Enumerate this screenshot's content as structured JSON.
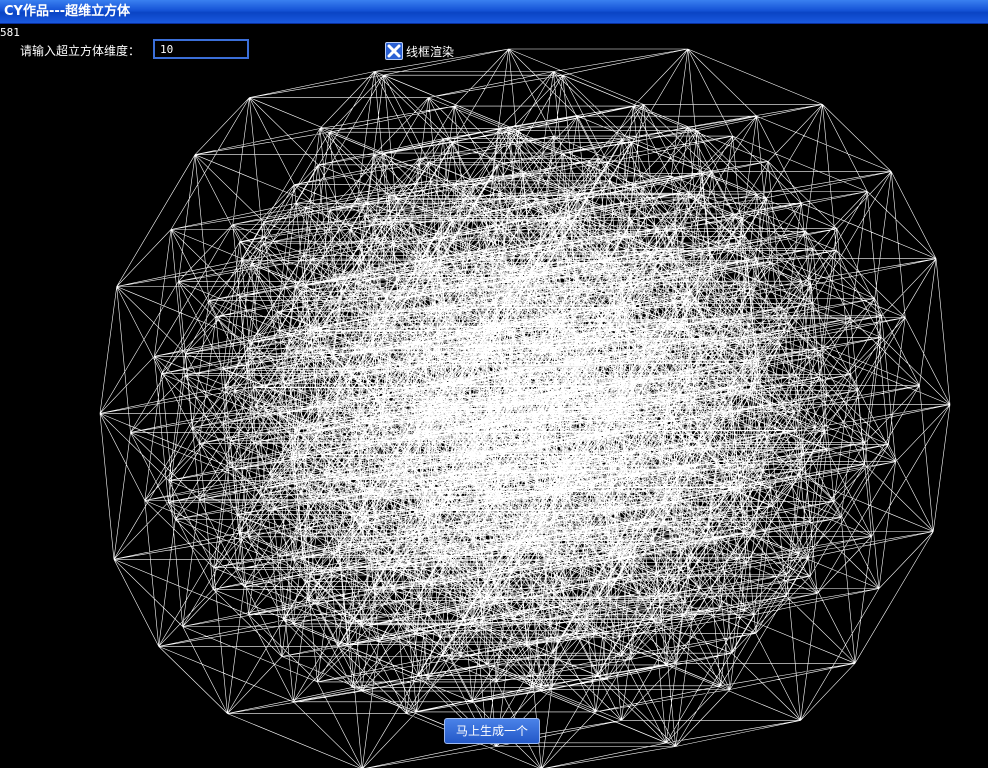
{
  "window": {
    "title": "CY作品---超维立方体"
  },
  "render": {
    "counter": "581",
    "line_color": "#ffffff",
    "background": "#000000"
  },
  "controls": {
    "dimension_label": "请输入超立方体维度：",
    "dimension_value": "10",
    "wireframe_label": "线框渲染",
    "wireframe_checked": true,
    "generate_button": "马上生成一个"
  },
  "colors": {
    "titlebar": "#1553d6",
    "accent": "#3b6fd9"
  }
}
